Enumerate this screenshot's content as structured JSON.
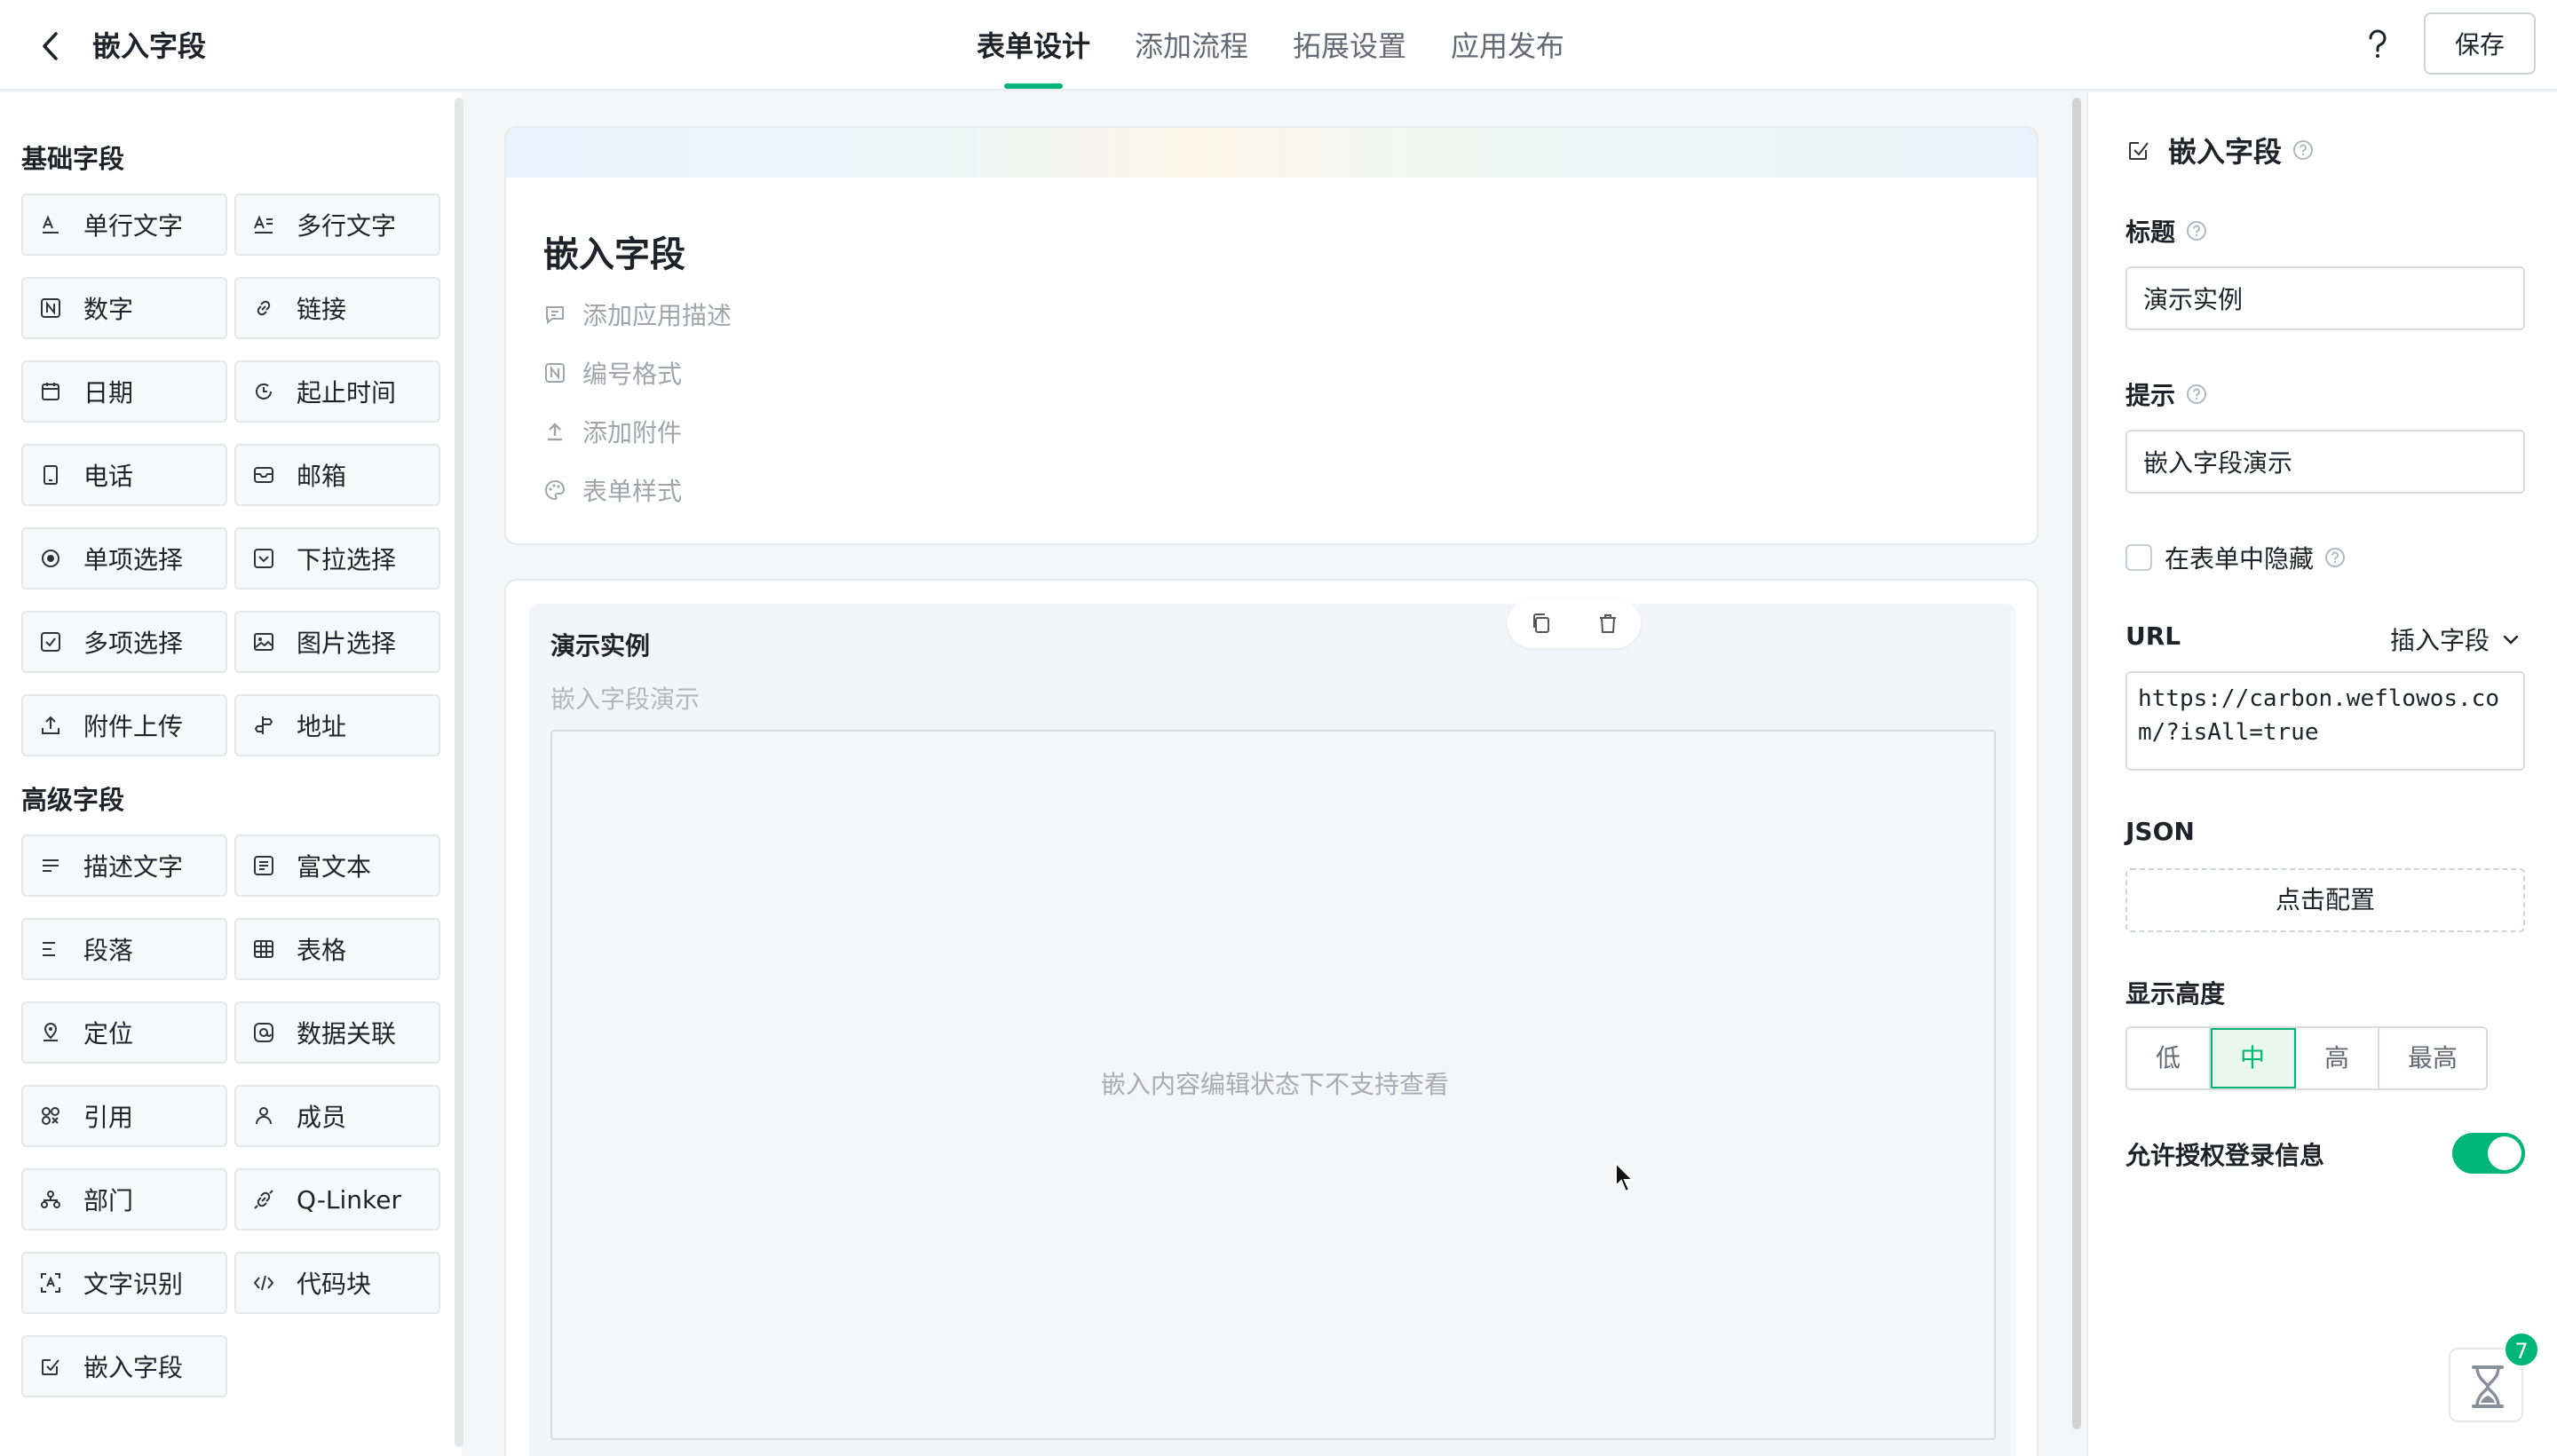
{
  "header": {
    "title": "嵌入字段",
    "tabs": [
      {
        "label": "表单设计",
        "active": true
      },
      {
        "label": "添加流程"
      },
      {
        "label": "拓展设置"
      },
      {
        "label": "应用发布"
      }
    ],
    "save_label": "保存"
  },
  "palette": {
    "basic_title": "基础字段",
    "basic": [
      {
        "label": "单行文字",
        "icon": "single-line-text-icon"
      },
      {
        "label": "多行文字",
        "icon": "multi-line-text-icon"
      },
      {
        "label": "数字",
        "icon": "number-icon"
      },
      {
        "label": "链接",
        "icon": "link-icon"
      },
      {
        "label": "日期",
        "icon": "calendar-icon"
      },
      {
        "label": "起止时间",
        "icon": "time-range-icon"
      },
      {
        "label": "电话",
        "icon": "phone-icon"
      },
      {
        "label": "邮箱",
        "icon": "mail-icon"
      },
      {
        "label": "单项选择",
        "icon": "radio-icon"
      },
      {
        "label": "下拉选择",
        "icon": "dropdown-icon"
      },
      {
        "label": "多项选择",
        "icon": "checkbox-icon"
      },
      {
        "label": "图片选择",
        "icon": "image-icon"
      },
      {
        "label": "附件上传",
        "icon": "upload-icon"
      },
      {
        "label": "地址",
        "icon": "address-icon"
      }
    ],
    "advanced_title": "高级字段",
    "advanced": [
      {
        "label": "描述文字",
        "icon": "description-icon"
      },
      {
        "label": "富文本",
        "icon": "rich-text-icon"
      },
      {
        "label": "段落",
        "icon": "paragraph-icon"
      },
      {
        "label": "表格",
        "icon": "table-icon"
      },
      {
        "label": "定位",
        "icon": "location-icon"
      },
      {
        "label": "数据关联",
        "icon": "data-link-icon"
      },
      {
        "label": "引用",
        "icon": "reference-icon"
      },
      {
        "label": "成员",
        "icon": "member-icon"
      },
      {
        "label": "部门",
        "icon": "department-icon"
      },
      {
        "label": "Q-Linker",
        "icon": "q-linker-icon"
      },
      {
        "label": "文字识别",
        "icon": "ocr-icon"
      },
      {
        "label": "代码块",
        "icon": "code-icon"
      },
      {
        "label": "嵌入字段",
        "icon": "embed-icon"
      }
    ]
  },
  "form": {
    "title": "嵌入字段",
    "meta": [
      {
        "label": "添加应用描述",
        "icon": "comment-icon"
      },
      {
        "label": "编号格式",
        "icon": "number-format-icon"
      },
      {
        "label": "添加附件",
        "icon": "attach-icon"
      },
      {
        "label": "表单样式",
        "icon": "palette-icon"
      }
    ]
  },
  "field": {
    "label": "演示实例",
    "hint": "嵌入字段演示",
    "embed_message": "嵌入内容编辑状态下不支持查看"
  },
  "props": {
    "title": "嵌入字段",
    "title_label": "标题",
    "title_value": "演示实例",
    "hint_label": "提示",
    "hint_value": "嵌入字段演示",
    "hide_label": "在表单中隐藏",
    "url_label": "URL",
    "insert_field": "插入字段",
    "url_value": "https://carbon.weflowos.com/?isAll=true",
    "json_label": "JSON",
    "json_button": "点击配置",
    "height_label": "显示高度",
    "heights": [
      "低",
      "中",
      "高",
      "最高"
    ],
    "height_selected": "中",
    "auth_label": "允许授权登录信息",
    "auth_enabled": true
  },
  "widget": {
    "badge": "7"
  },
  "colors": {
    "accent": "#00b578",
    "border": "#e4e6e9"
  }
}
